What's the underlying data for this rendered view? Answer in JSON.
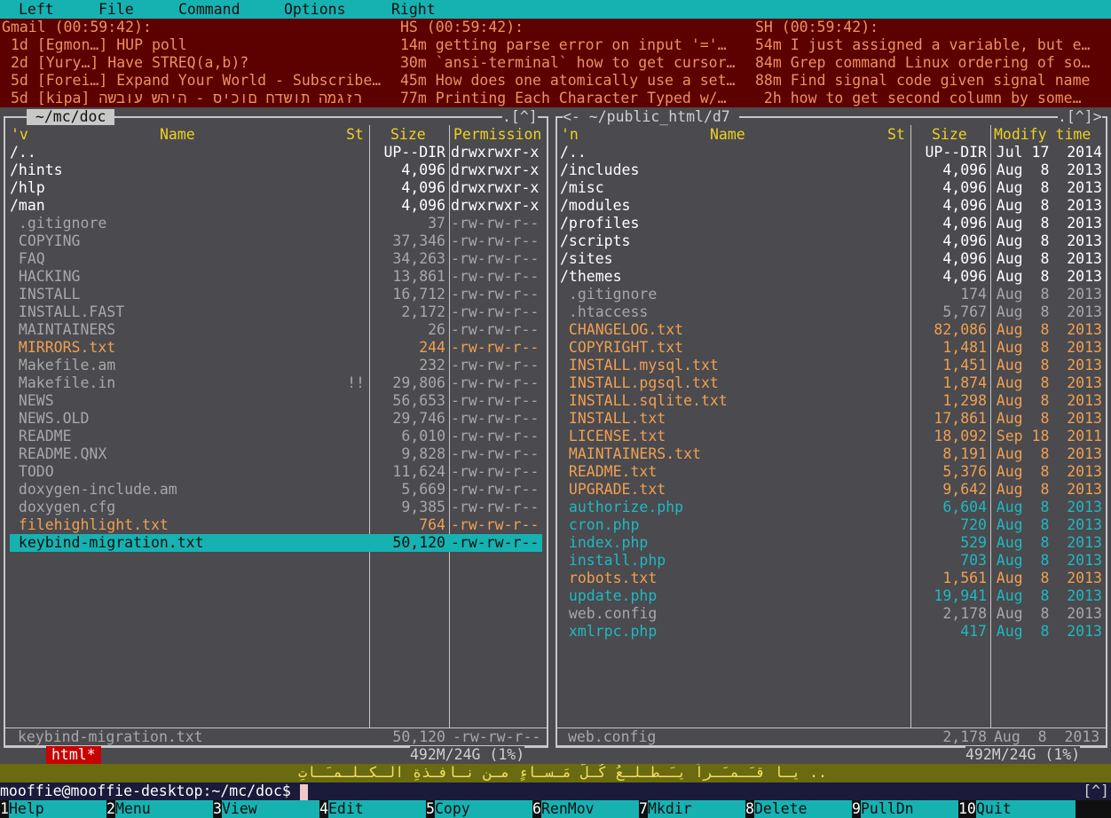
{
  "menu": [
    "Left",
    "File",
    "Command",
    "Options",
    "Right"
  ],
  "news": [
    {
      "header": "Gmail (00:59:42):",
      "items": [
        "1d [Egmon…] HUP poll",
        "2d [Yury…] Have STREQ(a,b)?",
        "5d [Forei…] Expand Your World - Subscribe…",
        "5d [kipa] רזגמה תושדח םוכיס - היהש עובשה"
      ]
    },
    {
      "header": "HS (00:59:42):",
      "items": [
        "14m getting parse error on input '='…",
        "30m `ansi-terminal` how to get cursor…",
        "45m How does one atomically use a set…",
        "77m Printing Each Character Typed w/…"
      ]
    },
    {
      "header": "SH (00:59:42):",
      "items": [
        "54m I just assigned a variable, but e…",
        "84m Grep command Linux ordering of so…",
        "88m Find signal code given signal name",
        " 2h how to get second column by some…"
      ]
    }
  ],
  "left": {
    "title": " ~/mc/doc ",
    "corner": ".[^]",
    "headers": {
      "sort": "'v",
      "name": "Name",
      "st": "St",
      "size": "Size",
      "last": "Permission"
    },
    "rows": [
      {
        "name": "/..",
        "st": "",
        "size": "UP--DIR",
        "last": "drwxrwxr-x",
        "type": "dir"
      },
      {
        "name": "/hints",
        "st": "",
        "size": "4,096",
        "last": "drwxrwxr-x",
        "type": "dir"
      },
      {
        "name": "/hlp",
        "st": "",
        "size": "4,096",
        "last": "drwxrwxr-x",
        "type": "dir"
      },
      {
        "name": "/man",
        "st": "",
        "size": "4,096",
        "last": "drwxrwxr-x",
        "type": "dir"
      },
      {
        "name": " .gitignore",
        "st": "",
        "size": "37",
        "last": "-rw-rw-r--",
        "type": "file"
      },
      {
        "name": " COPYING",
        "st": "",
        "size": "37,346",
        "last": "-rw-rw-r--",
        "type": "file"
      },
      {
        "name": " FAQ",
        "st": "",
        "size": "34,263",
        "last": "-rw-rw-r--",
        "type": "file"
      },
      {
        "name": " HACKING",
        "st": "",
        "size": "13,861",
        "last": "-rw-rw-r--",
        "type": "file"
      },
      {
        "name": " INSTALL",
        "st": "",
        "size": "16,712",
        "last": "-rw-rw-r--",
        "type": "file"
      },
      {
        "name": " INSTALL.FAST",
        "st": "",
        "size": "2,172",
        "last": "-rw-rw-r--",
        "type": "file"
      },
      {
        "name": " MAINTAINERS",
        "st": "",
        "size": "26",
        "last": "-rw-rw-r--",
        "type": "file"
      },
      {
        "name": " MIRRORS.txt",
        "st": "",
        "size": "244",
        "last": "-rw-rw-r--",
        "type": "doc"
      },
      {
        "name": " Makefile.am",
        "st": "",
        "size": "232",
        "last": "-rw-rw-r--",
        "type": "file"
      },
      {
        "name": " Makefile.in",
        "st": "!!",
        "size": "29,806",
        "last": "-rw-rw-r--",
        "type": "file"
      },
      {
        "name": " NEWS",
        "st": "",
        "size": "56,653",
        "last": "-rw-rw-r--",
        "type": "file"
      },
      {
        "name": " NEWS.OLD",
        "st": "",
        "size": "29,746",
        "last": "-rw-rw-r--",
        "type": "file"
      },
      {
        "name": " README",
        "st": "",
        "size": "6,010",
        "last": "-rw-rw-r--",
        "type": "file"
      },
      {
        "name": " README.QNX",
        "st": "",
        "size": "9,828",
        "last": "-rw-rw-r--",
        "type": "file"
      },
      {
        "name": " TODO",
        "st": "",
        "size": "11,624",
        "last": "-rw-rw-r--",
        "type": "file"
      },
      {
        "name": " doxygen-include.am",
        "st": "",
        "size": "5,669",
        "last": "-rw-rw-r--",
        "type": "file"
      },
      {
        "name": " doxygen.cfg",
        "st": "",
        "size": "9,385",
        "last": "-rw-rw-r--",
        "type": "file"
      },
      {
        "name": " filehighlight.txt",
        "st": "",
        "size": "764",
        "last": "-rw-rw-r--",
        "type": "doc"
      },
      {
        "name": " keybind-migration.txt",
        "st": "",
        "size": "50,120",
        "last": "-rw-rw-r--",
        "type": "sel"
      }
    ],
    "status": {
      "name": "keybind-migration.txt",
      "size": "50,120",
      "last": "-rw-rw-r--"
    },
    "tag": "html*",
    "free": "492M/24G (1%)"
  },
  "right": {
    "title": "<- ~/public_html/d7 ",
    "corner": ".[^]>",
    "headers": {
      "sort": "'n",
      "name": "Name",
      "st": "St",
      "size": "Size",
      "last": "Modify time"
    },
    "rows": [
      {
        "name": "/..",
        "st": "",
        "size": "UP--DIR",
        "last": "Jul 17  2014",
        "type": "dir"
      },
      {
        "name": "/includes",
        "st": "",
        "size": "4,096",
        "last": "Aug  8  2013",
        "type": "dir"
      },
      {
        "name": "/misc",
        "st": "",
        "size": "4,096",
        "last": "Aug  8  2013",
        "type": "dir"
      },
      {
        "name": "/modules",
        "st": "",
        "size": "4,096",
        "last": "Aug  8  2013",
        "type": "dir"
      },
      {
        "name": "/profiles",
        "st": "",
        "size": "4,096",
        "last": "Aug  8  2013",
        "type": "dir"
      },
      {
        "name": "/scripts",
        "st": "",
        "size": "4,096",
        "last": "Aug  8  2013",
        "type": "dir"
      },
      {
        "name": "/sites",
        "st": "",
        "size": "4,096",
        "last": "Aug  8  2013",
        "type": "dir"
      },
      {
        "name": "/themes",
        "st": "",
        "size": "4,096",
        "last": "Aug  8  2013",
        "type": "dir"
      },
      {
        "name": " .gitignore",
        "st": "",
        "size": "174",
        "last": "Aug  8  2013",
        "type": "file"
      },
      {
        "name": " .htaccess",
        "st": "",
        "size": "5,767",
        "last": "Aug  8  2013",
        "type": "file"
      },
      {
        "name": " CHANGELOG.txt",
        "st": "",
        "size": "82,086",
        "last": "Aug  8  2013",
        "type": "doc"
      },
      {
        "name": " COPYRIGHT.txt",
        "st": "",
        "size": "1,481",
        "last": "Aug  8  2013",
        "type": "doc"
      },
      {
        "name": " INSTALL.mysql.txt",
        "st": "",
        "size": "1,451",
        "last": "Aug  8  2013",
        "type": "doc"
      },
      {
        "name": " INSTALL.pgsql.txt",
        "st": "",
        "size": "1,874",
        "last": "Aug  8  2013",
        "type": "doc"
      },
      {
        "name": " INSTALL.sqlite.txt",
        "st": "",
        "size": "1,298",
        "last": "Aug  8  2013",
        "type": "doc"
      },
      {
        "name": " INSTALL.txt",
        "st": "",
        "size": "17,861",
        "last": "Aug  8  2013",
        "type": "doc"
      },
      {
        "name": " LICENSE.txt",
        "st": "",
        "size": "18,092",
        "last": "Sep 18  2011",
        "type": "doc"
      },
      {
        "name": " MAINTAINERS.txt",
        "st": "",
        "size": "8,191",
        "last": "Aug  8  2013",
        "type": "doc"
      },
      {
        "name": " README.txt",
        "st": "",
        "size": "5,376",
        "last": "Aug  8  2013",
        "type": "doc"
      },
      {
        "name": " UPGRADE.txt",
        "st": "",
        "size": "9,642",
        "last": "Aug  8  2013",
        "type": "doc"
      },
      {
        "name": " authorize.php",
        "st": "",
        "size": "6,604",
        "last": "Aug  8  2013",
        "type": "php"
      },
      {
        "name": " cron.php",
        "st": "",
        "size": "720",
        "last": "Aug  8  2013",
        "type": "php"
      },
      {
        "name": " index.php",
        "st": "",
        "size": "529",
        "last": "Aug  8  2013",
        "type": "php"
      },
      {
        "name": " install.php",
        "st": "",
        "size": "703",
        "last": "Aug  8  2013",
        "type": "php"
      },
      {
        "name": " robots.txt",
        "st": "",
        "size": "1,561",
        "last": "Aug  8  2013",
        "type": "doc"
      },
      {
        "name": " update.php",
        "st": "",
        "size": "19,941",
        "last": "Aug  8  2013",
        "type": "php"
      },
      {
        "name": " web.config",
        "st": "",
        "size": "2,178",
        "last": "Aug  8  2013",
        "type": "file"
      },
      {
        "name": " xmlrpc.php",
        "st": "",
        "size": "417",
        "last": "Aug  8  2013",
        "type": "php"
      }
    ],
    "status": {
      "name": "web.config",
      "size": "2,178",
      "last": "Aug  8  2013"
    },
    "free": "492M/24G (1%)"
  },
  "hint": "يـا قـَـمـَـراً يـَـطـلـعُ كُـلّ مَـسـاءٍ مـن نـافـذةِ الـكـلـمـَـاتِ ..",
  "prompt": "mooffie@mooffie-desktop:~/mc/doc$ ",
  "prompt_right": "[^]",
  "fkeys": [
    {
      "num": "1",
      "label": "Help"
    },
    {
      "num": "2",
      "label": "Menu"
    },
    {
      "num": "3",
      "label": "View"
    },
    {
      "num": "4",
      "label": "Edit"
    },
    {
      "num": "5",
      "label": "Copy"
    },
    {
      "num": "6",
      "label": "RenMov"
    },
    {
      "num": "7",
      "label": "Mkdir"
    },
    {
      "num": "8",
      "label": "Delete"
    },
    {
      "num": "9",
      "label": "PullDn"
    },
    {
      "num": "10",
      "label": "Quit"
    }
  ],
  "colors": {
    "cyan": "#16b2b2",
    "news_bg": "#5c0000",
    "panel_bg": "#4a4a4f",
    "doc": "#f0a050",
    "php": "#20b8c0",
    "header": "#f0d020"
  }
}
